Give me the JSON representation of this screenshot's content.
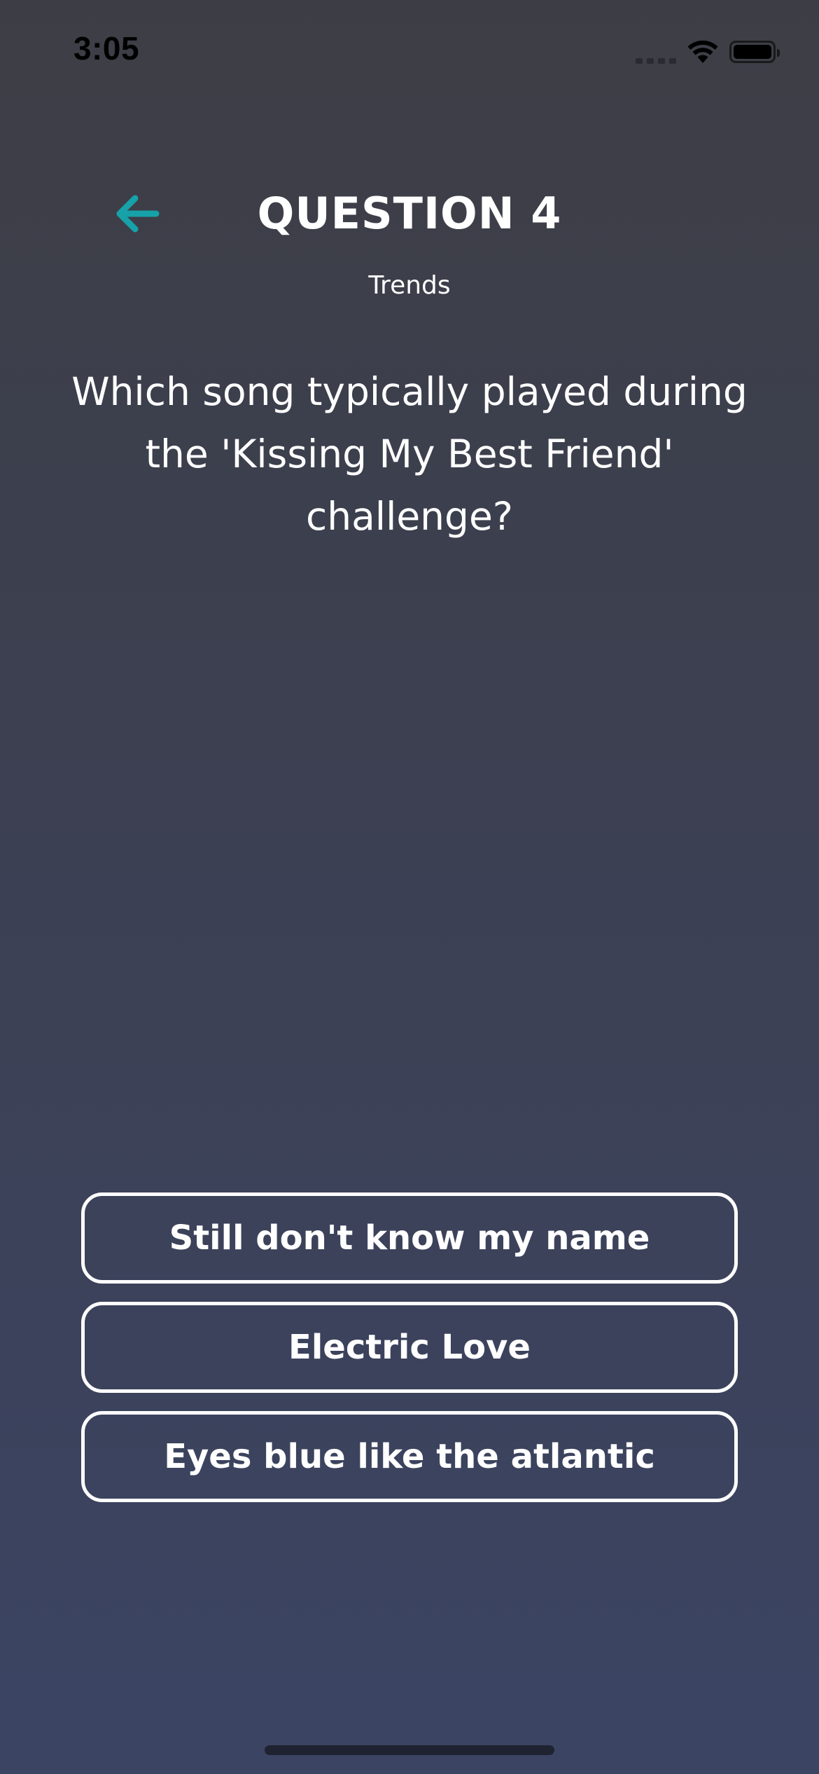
{
  "status_bar": {
    "time": "3:05",
    "icons": [
      "cellular-signal-icon",
      "wifi-icon",
      "battery-icon"
    ]
  },
  "header": {
    "back_icon": "arrow-left-icon",
    "title": "QUESTION 4",
    "category": "Trends"
  },
  "question": {
    "text": "Which song typically played during the 'Kissing My Best Friend' challenge?"
  },
  "answers": [
    {
      "label": "Still don't know my name"
    },
    {
      "label": "Electric Love"
    },
    {
      "label": "Eyes blue like the atlantic"
    }
  ],
  "colors": {
    "accent": "#16a2a8",
    "background_top": "#3d3e45",
    "background_bottom": "#3b4463",
    "text": "#ffffff"
  }
}
